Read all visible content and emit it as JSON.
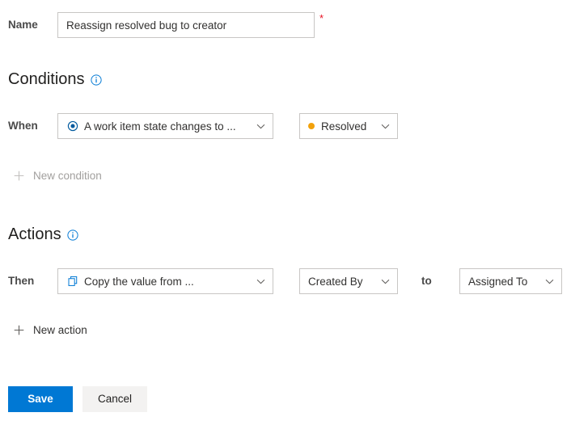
{
  "form": {
    "name": {
      "label": "Name",
      "value": "Reassign resolved bug to creator",
      "placeholder": "",
      "required_marker": "*"
    }
  },
  "conditions": {
    "heading": "Conditions",
    "info_icon": "info-icon",
    "when_label": "When",
    "type_dropdown": {
      "value": "A work item state changes to ...",
      "icon": "work-item-state-icon",
      "icon_color": "#0078d4"
    },
    "value_dropdown": {
      "value": "Resolved",
      "icon": "state-dot-icon",
      "dot_color": "#f2a10b"
    },
    "new_condition_label": "New condition",
    "new_condition_icon": "plus-icon",
    "new_condition_disabled": true
  },
  "actions": {
    "heading": "Actions",
    "info_icon": "info-icon",
    "then_label": "Then",
    "type_dropdown": {
      "value": "Copy the value from ...",
      "icon": "copy-icon",
      "icon_color": "#0078d4"
    },
    "source_dropdown": {
      "value": "Created By"
    },
    "connector_word": "to",
    "target_dropdown": {
      "value": "Assigned To"
    },
    "new_action_label": "New action",
    "new_action_icon": "plus-icon",
    "new_action_disabled": false
  },
  "footer": {
    "save_label": "Save",
    "cancel_label": "Cancel"
  },
  "colors": {
    "primary": "#0078d4",
    "required": "#e81123",
    "resolved_state": "#f2a10b",
    "border": "#c8c6c4",
    "disabled_text": "#a19f9d",
    "background": "#ffffff"
  }
}
